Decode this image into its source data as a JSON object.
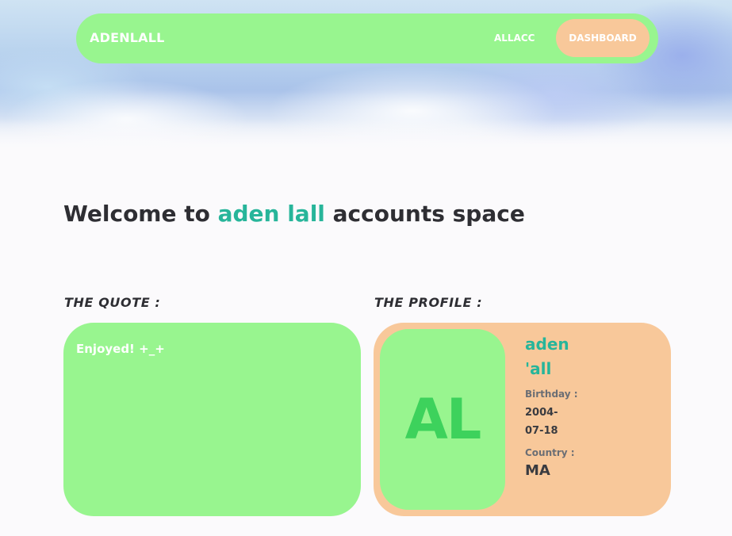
{
  "navbar": {
    "brand": "ADENLALL",
    "links": [
      {
        "label": "ALLACC"
      },
      {
        "label": "DASHBOARD"
      }
    ]
  },
  "welcome": {
    "prefix": "Welcome to ",
    "highlight": "aden lall",
    "suffix": " accounts space"
  },
  "quote": {
    "heading": "THE QUOTE :",
    "text": "Enjoyed! +_+"
  },
  "profile": {
    "heading": "THE PROFILE :",
    "avatar_initials": "AL",
    "first_name": "aden",
    "last_name": "'all",
    "birthday_label": "Birthday :",
    "birthday_value": "2004-07-18",
    "country_label": "Country :",
    "country_value": "MA"
  },
  "colors": {
    "green_card": "#98f58f",
    "peach_card": "#f8c89a",
    "accent_teal": "#27b59a",
    "avatar_text": "#3dd25c"
  }
}
